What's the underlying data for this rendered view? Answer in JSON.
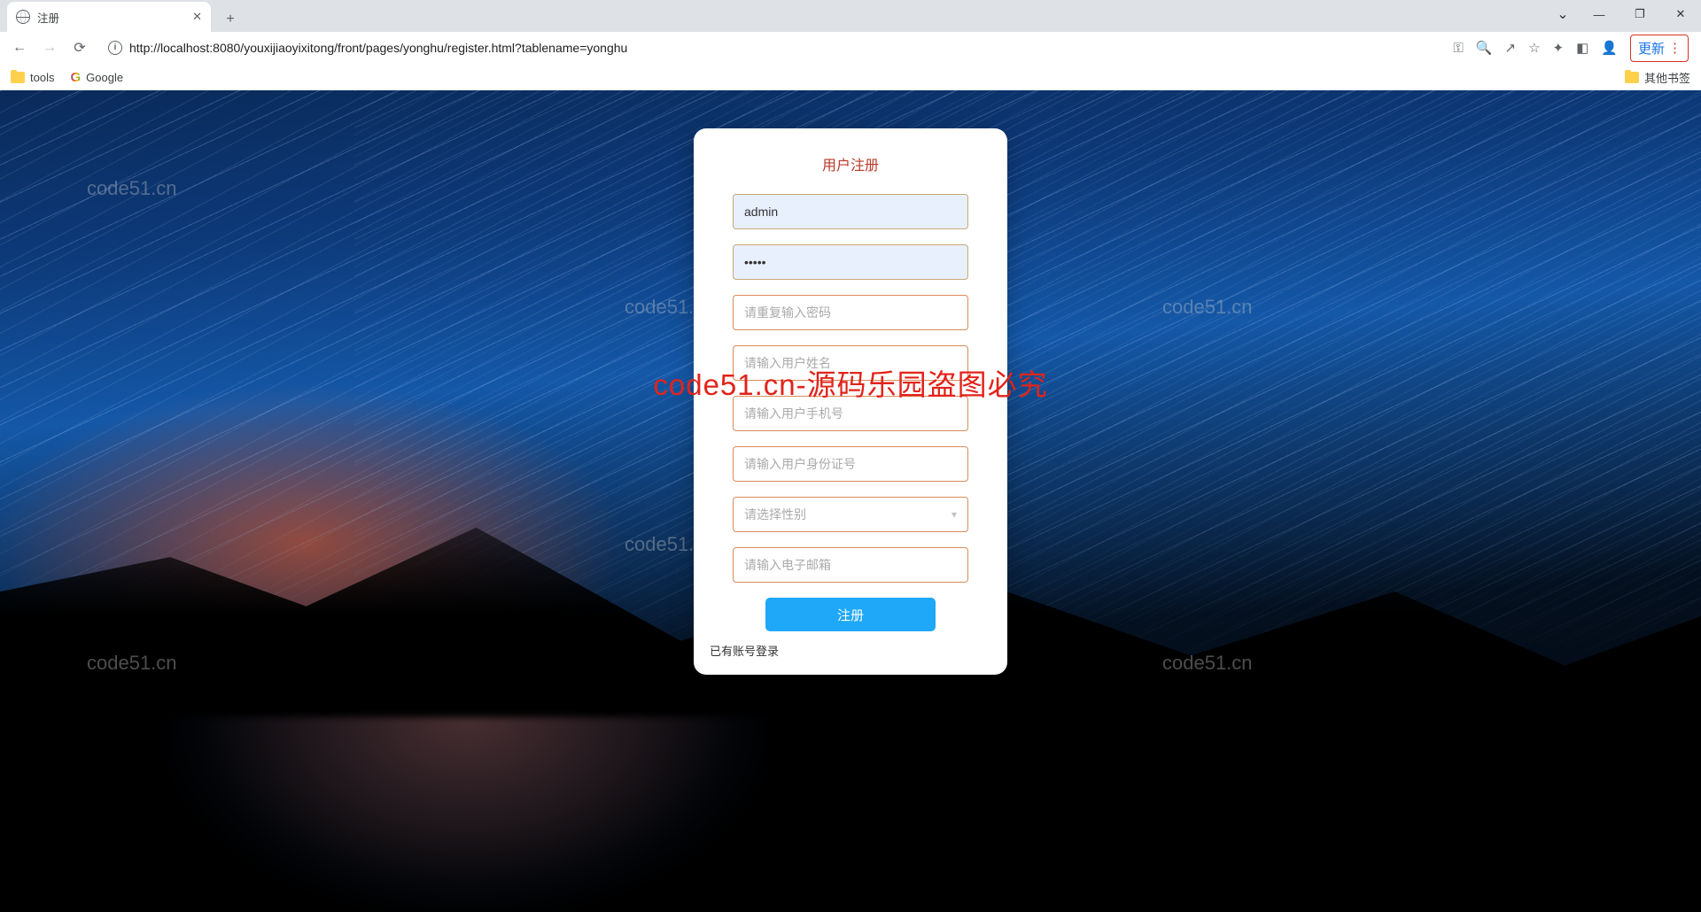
{
  "browser": {
    "tab_title": "注册",
    "url": "http://localhost:8080/youxijiaoyixitong/front/pages/yonghu/register.html?tablename=yonghu",
    "update_label": "更新",
    "bookmarks": {
      "tools": "tools",
      "google": "Google",
      "other": "其他书签"
    }
  },
  "form": {
    "title": "用户注册",
    "username_value": "admin",
    "password_value": "•••••",
    "confirm_placeholder": "请重复输入密码",
    "name_placeholder": "请输入用户姓名",
    "phone_placeholder": "请输入用户手机号",
    "idcard_placeholder": "请输入用户身份证号",
    "gender_placeholder": "请选择性别",
    "email_placeholder": "请输入电子邮箱",
    "submit_label": "注册",
    "login_link": "已有账号登录"
  },
  "watermarks": {
    "small": "code51.cn",
    "big": "code51.cn-源码乐园盗图必究"
  }
}
